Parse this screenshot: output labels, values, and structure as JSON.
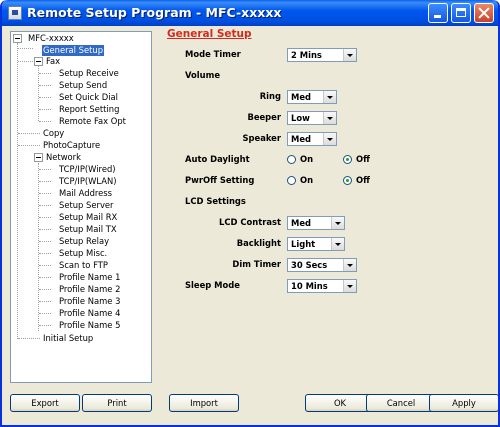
{
  "window": {
    "title": "Remote Setup Program - MFC-xxxxx",
    "title_color": "#0058ee"
  },
  "tree": {
    "root": "MFC-xxxxx",
    "general_setup": "General Setup",
    "fax": "Fax",
    "fax_children": [
      "Setup Receive",
      "Setup Send",
      "Set Quick Dial",
      "Report Setting",
      "Remote Fax Opt"
    ],
    "copy": "Copy",
    "photocapture": "PhotoCapture",
    "network": "Network",
    "network_children": [
      "TCP/IP(Wired)",
      "TCP/IP(WLAN)",
      "Mail Address",
      "Setup Server",
      "Setup Mail RX",
      "Setup Mail TX",
      "Setup Relay",
      "Setup Misc.",
      "Scan to FTP",
      "Profile Name 1",
      "Profile Name 2",
      "Profile Name 3",
      "Profile Name 4",
      "Profile Name 5"
    ],
    "initial_setup": "Initial Setup",
    "selected": "General Setup"
  },
  "panel": {
    "title": "General Setup",
    "title_color": "#d12b1f",
    "mode_timer": {
      "label": "Mode Timer",
      "value": "2 Mins"
    },
    "volume": {
      "heading": "Volume",
      "ring": {
        "label": "Ring",
        "value": "Med"
      },
      "beeper": {
        "label": "Beeper",
        "value": "Low"
      },
      "speaker": {
        "label": "Speaker",
        "value": "Med"
      }
    },
    "auto_daylight": {
      "label": "Auto Daylight",
      "on": "On",
      "off": "Off",
      "selected": "Off"
    },
    "pwroff_setting": {
      "label": "PwrOff Setting",
      "on": "On",
      "off": "Off",
      "selected": "Off"
    },
    "lcd": {
      "heading": "LCD Settings",
      "contrast": {
        "label": "LCD Contrast",
        "value": "Med"
      },
      "backlight": {
        "label": "Backlight",
        "value": "Light"
      },
      "dim_timer": {
        "label": "Dim Timer",
        "value": "30 Secs"
      }
    },
    "sleep_mode": {
      "label": "Sleep Mode",
      "value": "10 Mins"
    }
  },
  "buttons": {
    "export": "Export",
    "print": "Print",
    "import": "Import",
    "ok": "OK",
    "cancel": "Cancel",
    "apply": "Apply"
  },
  "icons": [
    "app-icon",
    "minimize-icon",
    "maximize-icon",
    "close-icon",
    "tree-collapse-icon",
    "dropdown-arrow-icon"
  ]
}
